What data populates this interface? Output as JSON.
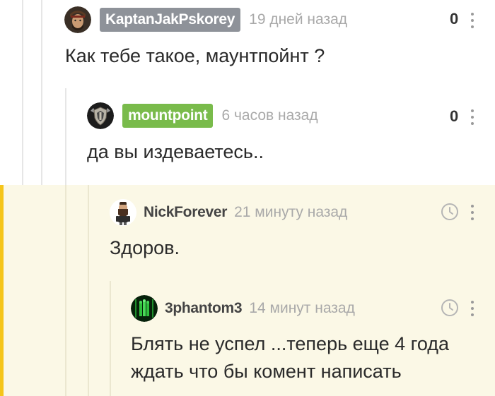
{
  "comments": [
    {
      "author": "KaptanJakPskorey",
      "author_badge_color": "#8e9299",
      "time": "19 дней назад",
      "rating": "0",
      "text": "Как тебе такое, маунтпойнт ?",
      "avatar_icon": "pirate-avatar-icon"
    },
    {
      "author": "mountpoint",
      "author_badge_color": "#79bb4b",
      "time": "6 часов назад",
      "rating": "0",
      "text": "да вы издеваетесь..",
      "avatar_icon": "shield-emblem-avatar-icon"
    },
    {
      "author": "NickForever",
      "time": "21 минуту назад",
      "text": "Здоров.",
      "avatar_icon": "bearded-man-avatar-icon"
    },
    {
      "author": "3phantom3",
      "time": "14 минут назад",
      "text_line1": "Блять не успел ...теперь еще 4 года",
      "text_line2": "ждать что бы комент написать",
      "avatar_icon": "matrix-avatar-icon"
    }
  ],
  "colors": {
    "highlight_bg": "#fbf8e6",
    "accent_bar": "#f5c51a",
    "thread_line": "#e6e6e6"
  }
}
